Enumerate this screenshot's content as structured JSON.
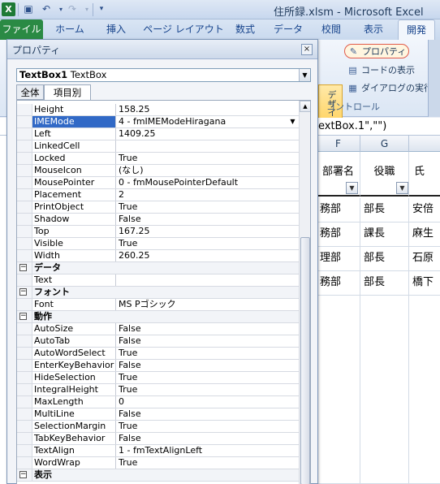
{
  "window": {
    "title": "住所録.xlsm - Microsoft Excel",
    "app_icon": "excel-icon"
  },
  "ribbon": {
    "tabs": [
      {
        "label": "ファイル"
      },
      {
        "label": "ホーム"
      },
      {
        "label": "挿入"
      },
      {
        "label": "ページ レイアウト"
      },
      {
        "label": "数式"
      },
      {
        "label": "データ"
      },
      {
        "label": "校閲"
      },
      {
        "label": "表示"
      },
      {
        "label": "開発"
      }
    ],
    "design_mode_label": "デザイン モード",
    "properties_label": "プロパティ",
    "view_code_label": "コードの表示",
    "run_dialog_label": "ダイアログの実行",
    "group_label": "コントロール"
  },
  "formula_bar": {
    "text": "extBox.1\",\"\")"
  },
  "sheet": {
    "columns": [
      "F",
      "G"
    ],
    "headers": [
      "部署名",
      "役職",
      "氏"
    ],
    "rows": [
      [
        "務部",
        "部長",
        "安倍"
      ],
      [
        "務部",
        "課長",
        "麻生"
      ],
      [
        "理部",
        "部長",
        "石原"
      ],
      [
        "務部",
        "部長",
        "橋下"
      ]
    ]
  },
  "properties_panel": {
    "title": "プロパティ",
    "object_name": "TextBox1",
    "object_type": "TextBox",
    "tabs": [
      "全体",
      "項目別"
    ],
    "rows": [
      {
        "kind": "prop",
        "name": "Height",
        "value": "158.25"
      },
      {
        "kind": "prop",
        "name": "IMEMode",
        "value": "4 - fmIMEModeHiragana",
        "selected": true
      },
      {
        "kind": "prop",
        "name": "Left",
        "value": "1409.25"
      },
      {
        "kind": "prop",
        "name": "LinkedCell",
        "value": ""
      },
      {
        "kind": "prop",
        "name": "Locked",
        "value": "True"
      },
      {
        "kind": "prop",
        "name": "MouseIcon",
        "value": "(なし)"
      },
      {
        "kind": "prop",
        "name": "MousePointer",
        "value": "0 - fmMousePointerDefault"
      },
      {
        "kind": "prop",
        "name": "Placement",
        "value": "2"
      },
      {
        "kind": "prop",
        "name": "PrintObject",
        "value": "True"
      },
      {
        "kind": "prop",
        "name": "Shadow",
        "value": "False"
      },
      {
        "kind": "prop",
        "name": "Top",
        "value": "167.25"
      },
      {
        "kind": "prop",
        "name": "Visible",
        "value": "True"
      },
      {
        "kind": "prop",
        "name": "Width",
        "value": "260.25"
      },
      {
        "kind": "cat",
        "name": "データ"
      },
      {
        "kind": "prop",
        "name": "Text",
        "value": ""
      },
      {
        "kind": "cat",
        "name": "フォント"
      },
      {
        "kind": "prop",
        "name": "Font",
        "value": "MS Pゴシック"
      },
      {
        "kind": "cat",
        "name": "動作"
      },
      {
        "kind": "prop",
        "name": "AutoSize",
        "value": "False"
      },
      {
        "kind": "prop",
        "name": "AutoTab",
        "value": "False"
      },
      {
        "kind": "prop",
        "name": "AutoWordSelect",
        "value": "True"
      },
      {
        "kind": "prop",
        "name": "EnterKeyBehavior",
        "value": "False"
      },
      {
        "kind": "prop",
        "name": "HideSelection",
        "value": "True"
      },
      {
        "kind": "prop",
        "name": "IntegralHeight",
        "value": "True"
      },
      {
        "kind": "prop",
        "name": "MaxLength",
        "value": "0"
      },
      {
        "kind": "prop",
        "name": "MultiLine",
        "value": "False"
      },
      {
        "kind": "prop",
        "name": "SelectionMargin",
        "value": "True"
      },
      {
        "kind": "prop",
        "name": "TabKeyBehavior",
        "value": "False"
      },
      {
        "kind": "prop",
        "name": "TextAlign",
        "value": "1 - fmTextAlignLeft"
      },
      {
        "kind": "prop",
        "name": "WordWrap",
        "value": "True"
      },
      {
        "kind": "cat",
        "name": "表示"
      }
    ]
  }
}
